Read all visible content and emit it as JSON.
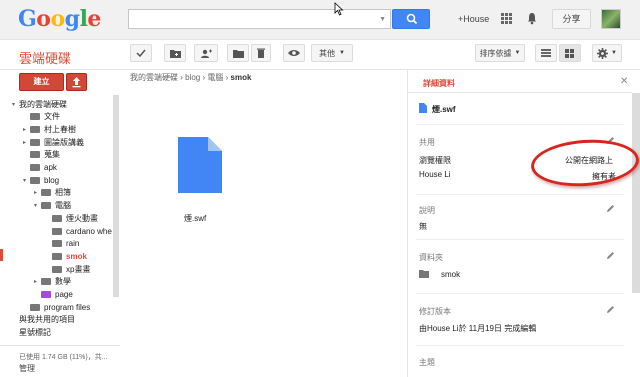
{
  "header": {
    "logo": [
      "G",
      "o",
      "o",
      "g",
      "l",
      "e"
    ],
    "user_link": "+House",
    "share_label": "分享"
  },
  "app": {
    "title": "雲端硬碟"
  },
  "toolbar": {
    "more_label": "其他",
    "sort_label": "排序依據"
  },
  "sidebar": {
    "create_label": "建立",
    "items": [
      {
        "label": "我的雲端硬碟",
        "depth": 0,
        "expander": "▾",
        "icon": "none"
      },
      {
        "label": "文件",
        "depth": 1,
        "expander": "",
        "icon": "folder"
      },
      {
        "label": "村上春樹",
        "depth": 1,
        "expander": "▸",
        "icon": "folder"
      },
      {
        "label": "圖論版講義",
        "depth": 1,
        "expander": "▸",
        "icon": "folder-shared"
      },
      {
        "label": "蒐集",
        "depth": 1,
        "expander": "",
        "icon": "folder-shared"
      },
      {
        "label": "apk",
        "depth": 1,
        "expander": "",
        "icon": "folder-shared"
      },
      {
        "label": "blog",
        "depth": 1,
        "expander": "▾",
        "icon": "folder-shared"
      },
      {
        "label": "相簿",
        "depth": 2,
        "expander": "▸",
        "icon": "folder-shared"
      },
      {
        "label": "電腦",
        "depth": 2,
        "expander": "▾",
        "icon": "folder-shared"
      },
      {
        "label": "煙火動畫",
        "depth": 3,
        "expander": "",
        "icon": "folder-shared"
      },
      {
        "label": "cardano whe",
        "depth": 3,
        "expander": "",
        "icon": "folder-shared"
      },
      {
        "label": "rain",
        "depth": 3,
        "expander": "",
        "icon": "folder-shared"
      },
      {
        "label": "smok",
        "depth": 3,
        "expander": "",
        "icon": "folder-shared",
        "active": true
      },
      {
        "label": "xp畫畫",
        "depth": 3,
        "expander": "",
        "icon": "folder-shared"
      },
      {
        "label": "數學",
        "depth": 2,
        "expander": "▸",
        "icon": "folder-shared"
      },
      {
        "label": "page",
        "depth": 2,
        "expander": "",
        "icon": "folder-purple"
      },
      {
        "label": "program files",
        "depth": 1,
        "expander": "",
        "icon": "folder"
      },
      {
        "label": "與我共用的項目",
        "depth": 0,
        "expander": "",
        "icon": "none"
      },
      {
        "label": "星號標記",
        "depth": 0,
        "expander": "",
        "icon": "none"
      }
    ],
    "quota_text": "已使用 1.74 GB (11%)，共...",
    "manage_label": "管理"
  },
  "breadcrumb": {
    "parts": [
      "我的雲端硬碟",
      "blog",
      "電腦"
    ],
    "current": "smok"
  },
  "file": {
    "name": "煙.swf"
  },
  "details": {
    "title": "詳細資料",
    "file_name": "煙.swf",
    "sharing_label": "共用",
    "visibility_label": "瀏覽權限",
    "visibility_value": "公開在網路上",
    "owner_name": "House Li",
    "owner_role": "擁有者",
    "description_label": "說明",
    "description_value": "無",
    "folder_label": "資料夾",
    "folder_value": "smok",
    "revisions_label": "修訂版本",
    "revisions_value": "由House Li於 11月19日 完成編輯",
    "theme_label": "主題"
  },
  "colors": {
    "accent_red": "#dd4b39",
    "blue": "#4285f4",
    "folder_gray": "#777777",
    "folder_purple": "#a64ad9"
  }
}
